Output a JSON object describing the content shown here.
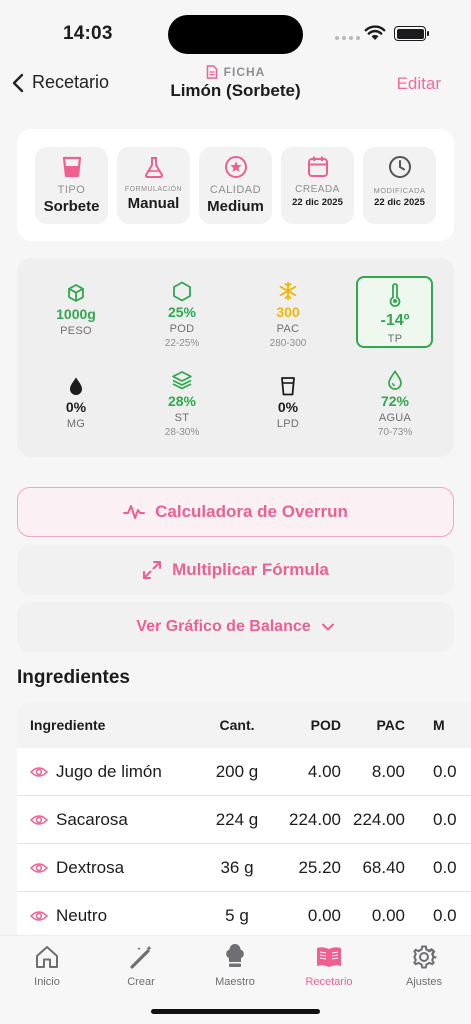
{
  "status": {
    "time": "14:03"
  },
  "nav": {
    "back_label": "Recetario",
    "sup": "FICHA",
    "title": "Limón (Sorbete)",
    "edit_label": "Editar"
  },
  "meta": [
    {
      "label": "TIPO",
      "value": "Sorbete",
      "icon": "cup-icon"
    },
    {
      "label": "FORMULACIÓN",
      "value": "Manual",
      "icon": "flask-icon"
    },
    {
      "label": "CALIDAD",
      "value": "Medium",
      "icon": "star-circle-icon"
    },
    {
      "label": "CREADA",
      "value": "22 dic 2025",
      "icon": "calendar-icon"
    },
    {
      "label": "MODIFICADA",
      "value": "22 dic 2025",
      "icon": "clock-icon"
    }
  ],
  "stats": [
    {
      "value": "1000g",
      "label": "PESO",
      "range": "",
      "color": "#2fa84f",
      "icon": "cube-icon"
    },
    {
      "value": "25%",
      "label": "POD",
      "range": "22-25%",
      "color": "#2fa84f",
      "icon": "hexagon-icon"
    },
    {
      "value": "300",
      "label": "PAC",
      "range": "280-300",
      "color": "#f2b705",
      "icon": "snowflake-icon"
    },
    {
      "value": "-14º",
      "label": "TP",
      "range": "",
      "color": "#2fa84f",
      "icon": "thermometer-icon"
    },
    {
      "value": "0%",
      "label": "MG",
      "range": "",
      "color": "#1c1c1e",
      "icon": "drop-icon"
    },
    {
      "value": "28%",
      "label": "ST",
      "range": "28-30%",
      "color": "#2fa84f",
      "icon": "layers-icon"
    },
    {
      "value": "0%",
      "label": "LPD",
      "range": "",
      "color": "#1c1c1e",
      "icon": "glass-icon"
    },
    {
      "value": "72%",
      "label": "AGUA",
      "range": "70-73%",
      "color": "#2fa84f",
      "icon": "water-drop-icon"
    }
  ],
  "actions": {
    "overrun": "Calculadora de Overrun",
    "multiply": "Multiplicar Fórmula",
    "balance": "Ver Gráfico de Balance"
  },
  "ingredients": {
    "title": "Ingredientes",
    "headers": [
      "Ingrediente",
      "Cant.",
      "POD",
      "PAC",
      "M"
    ],
    "rows": [
      {
        "name": "Jugo de limón",
        "cant": "200 g",
        "pod": "4.00",
        "pac": "8.00",
        "m": "0.0"
      },
      {
        "name": "Sacarosa",
        "cant": "224 g",
        "pod": "224.00",
        "pac": "224.00",
        "m": "0.0"
      },
      {
        "name": "Dextrosa",
        "cant": "36 g",
        "pod": "25.20",
        "pac": "68.40",
        "m": "0.0"
      },
      {
        "name": "Neutro",
        "cant": "5 g",
        "pod": "0.00",
        "pac": "0.00",
        "m": "0.0"
      }
    ]
  },
  "tabs": [
    {
      "label": "Inicio",
      "icon": "house-icon",
      "active": false
    },
    {
      "label": "Crear",
      "icon": "magic-wand-icon",
      "active": false
    },
    {
      "label": "Maestro",
      "icon": "chef-hat-icon",
      "active": false
    },
    {
      "label": "Recetario",
      "icon": "book-icon",
      "active": true
    },
    {
      "label": "Ajustes",
      "icon": "gear-icon",
      "active": false
    }
  ],
  "colors": {
    "accent": "#ef5f8f",
    "good": "#2fa84f",
    "warn": "#f2b705"
  }
}
